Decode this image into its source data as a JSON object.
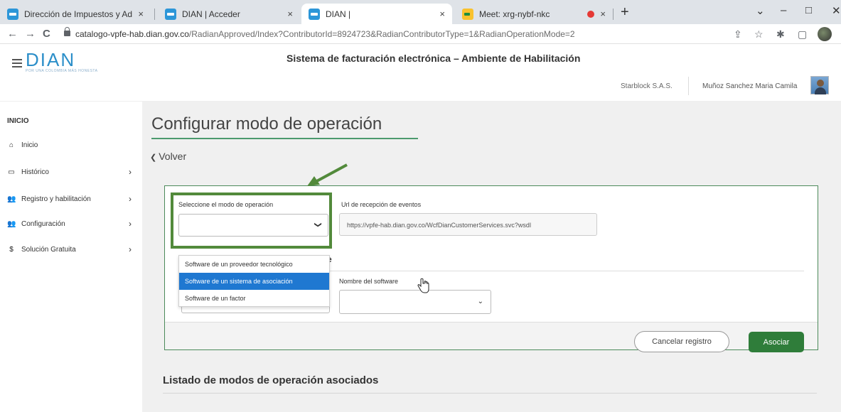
{
  "browser": {
    "tabs": [
      {
        "title": "Dirección de Impuestos y Aduan",
        "icon": "dian-favicon-icon"
      },
      {
        "title": "DIAN | Acceder",
        "icon": "dian-favicon-icon"
      },
      {
        "title": "DIAN |",
        "icon": "dian-favicon-icon"
      },
      {
        "title": "Meet: xrg-nybf-nkc",
        "icon": "meet-favicon-icon"
      }
    ],
    "close_glyph": "×",
    "new_tab_glyph": "+",
    "url_host": "catalogo-vpfe-hab.dian.gov.co",
    "url_path": "/RadianApproved/Index?ContributorId=8924723&RadianContributorType=1&RadianOperationMode=2",
    "window_controls": [
      "⌄",
      "–",
      "□",
      "✕"
    ],
    "nav": [
      "←",
      "→",
      "C"
    ]
  },
  "header": {
    "logo": "DIAN",
    "logo_tagline": "POR UNA COLOMBIA MÁS HONESTA",
    "system_title": "Sistema de facturación electrónica – Ambiente de Habilitación",
    "company": "Starblock S.A.S.",
    "user": "Muñoz Sanchez Maria Camila"
  },
  "sidebar": {
    "heading": "INICIO",
    "items": [
      {
        "label": "Inicio",
        "icon": "home-icon",
        "glyph": "⌂",
        "chevron": false
      },
      {
        "label": "Histórico",
        "icon": "inbox-icon",
        "glyph": "▭",
        "chevron": true
      },
      {
        "label": "Registro y habilitación",
        "icon": "users-icon",
        "glyph": "👥",
        "chevron": true
      },
      {
        "label": "Configuración",
        "icon": "users-cog-icon",
        "glyph": "👥",
        "chevron": true
      },
      {
        "label": "Solución Gratuita",
        "icon": "dollar-icon",
        "glyph": "$",
        "chevron": true
      }
    ],
    "chevron_glyph": "›"
  },
  "main": {
    "title": "Configurar modo de operación",
    "back_label": "Volver",
    "form": {
      "mode_label": "Seleccione el modo de operación",
      "mode_value": "",
      "url_label": "Url de recepción de eventos",
      "url_value": "https://vpfe-hab.dian.gov.co/WcfDianCustomerServices.svc?wsdl",
      "section_heading_tail": "e",
      "software_label": "Nombre del software",
      "software_value": "",
      "dropdown_options": [
        "Software de un proveedor tecnológico",
        "Software de un sistema de asociación",
        "Software de un factor"
      ],
      "dropdown_selected_index": 1,
      "cancel_label": "Cancelar registro",
      "associate_label": "Asociar"
    },
    "list_title": "Listado de modos de operación asociados"
  },
  "colors": {
    "highlight_box": "#528a3b",
    "accent_green": "#2f7d3a",
    "selected_option": "#1f78d1",
    "logo_blue": "#2c8fc9"
  }
}
